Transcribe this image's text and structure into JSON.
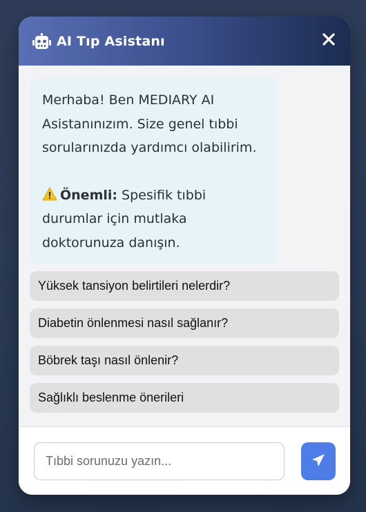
{
  "header": {
    "title": "AI Tıp Asistanı",
    "icon": "robot-icon",
    "close_icon": "close-icon"
  },
  "message": {
    "greeting": "Merhaba! Ben MEDIARY AI Asistanınızım. Size genel tıbbi sorularınızda yardımcı olabilirim.",
    "warning_icon": "warning-icon",
    "warning_label": "Önemli:",
    "warning_text": "Spesifik tıbbi durumlar için mutlaka doktorunuza danışın."
  },
  "suggestions": [
    "Yüksek tansiyon belirtileri nelerdir?",
    "Diabetin önlenmesi nasıl sağlanır?",
    "Böbrek taşı nasıl önlenir?",
    "Sağlıklı beslenme önerileri"
  ],
  "input": {
    "placeholder": "Tıbbi sorunuzu yazın...",
    "value": ""
  },
  "send": {
    "icon": "paper-plane-icon"
  },
  "colors": {
    "header_gradient_start": "#5a6fb5",
    "header_gradient_end": "#1c2c50",
    "bubble_bg": "#e6f4f8",
    "suggestion_bg": "#e0e0e0",
    "send_button": "#4f7de8",
    "backdrop": "#2b3a56"
  }
}
